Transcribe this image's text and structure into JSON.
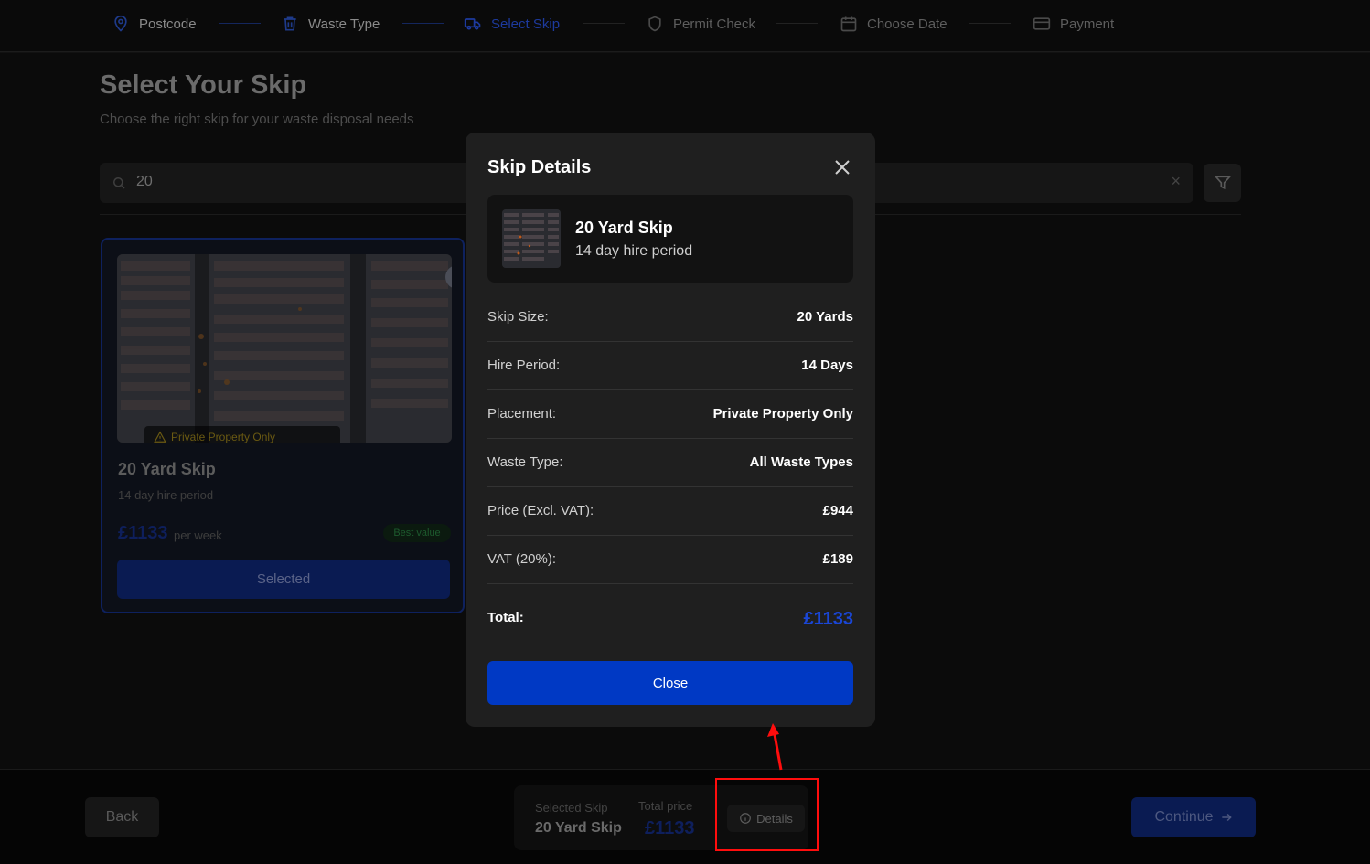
{
  "steps": [
    {
      "label": "Postcode",
      "icon": "map-pin-icon",
      "state": "done"
    },
    {
      "label": "Waste Type",
      "icon": "trash-icon",
      "state": "done"
    },
    {
      "label": "Select Skip",
      "icon": "truck-icon",
      "state": "active"
    },
    {
      "label": "Permit Check",
      "icon": "shield-icon",
      "state": "pending"
    },
    {
      "label": "Choose Date",
      "icon": "calendar-icon",
      "state": "pending"
    },
    {
      "label": "Payment",
      "icon": "credit-card-icon",
      "state": "pending"
    }
  ],
  "page": {
    "title": "Select Your Skip",
    "subtitle": "Choose the right skip for your waste disposal needs"
  },
  "search": {
    "value": "20",
    "clear_icon": "×"
  },
  "card": {
    "badge": "Private Property Only",
    "title": "20 Yard Skip",
    "subtitle": "14 day hire period",
    "price": "£1133",
    "per": "per week",
    "tag": "Best value",
    "button": "Selected",
    "check": "✓"
  },
  "bottom": {
    "back": "Back",
    "selected_label": "Selected Skip",
    "selected_value": "20 Yard Skip",
    "total_label": "Total price",
    "total_value": "£1133",
    "details": "Details",
    "continue": "Continue"
  },
  "modal": {
    "title": "Skip Details",
    "skip_name": "20 Yard Skip",
    "skip_sub": "14 day hire period",
    "rows": [
      {
        "label": "Skip Size:",
        "value": "20 Yards"
      },
      {
        "label": "Hire Period:",
        "value": "14 Days"
      },
      {
        "label": "Placement:",
        "value": "Private Property Only"
      },
      {
        "label": "Waste Type:",
        "value": "All Waste Types"
      },
      {
        "label": "Price (Excl. VAT):",
        "value": "£944"
      },
      {
        "label": "VAT (20%):",
        "value": "£189"
      }
    ],
    "total_label": "Total:",
    "total_value": "£1133",
    "close_button": "Close"
  },
  "colors": {
    "accent": "#0039c4",
    "total_text": "#1a46d6",
    "annotation": "#ff0d0d"
  }
}
